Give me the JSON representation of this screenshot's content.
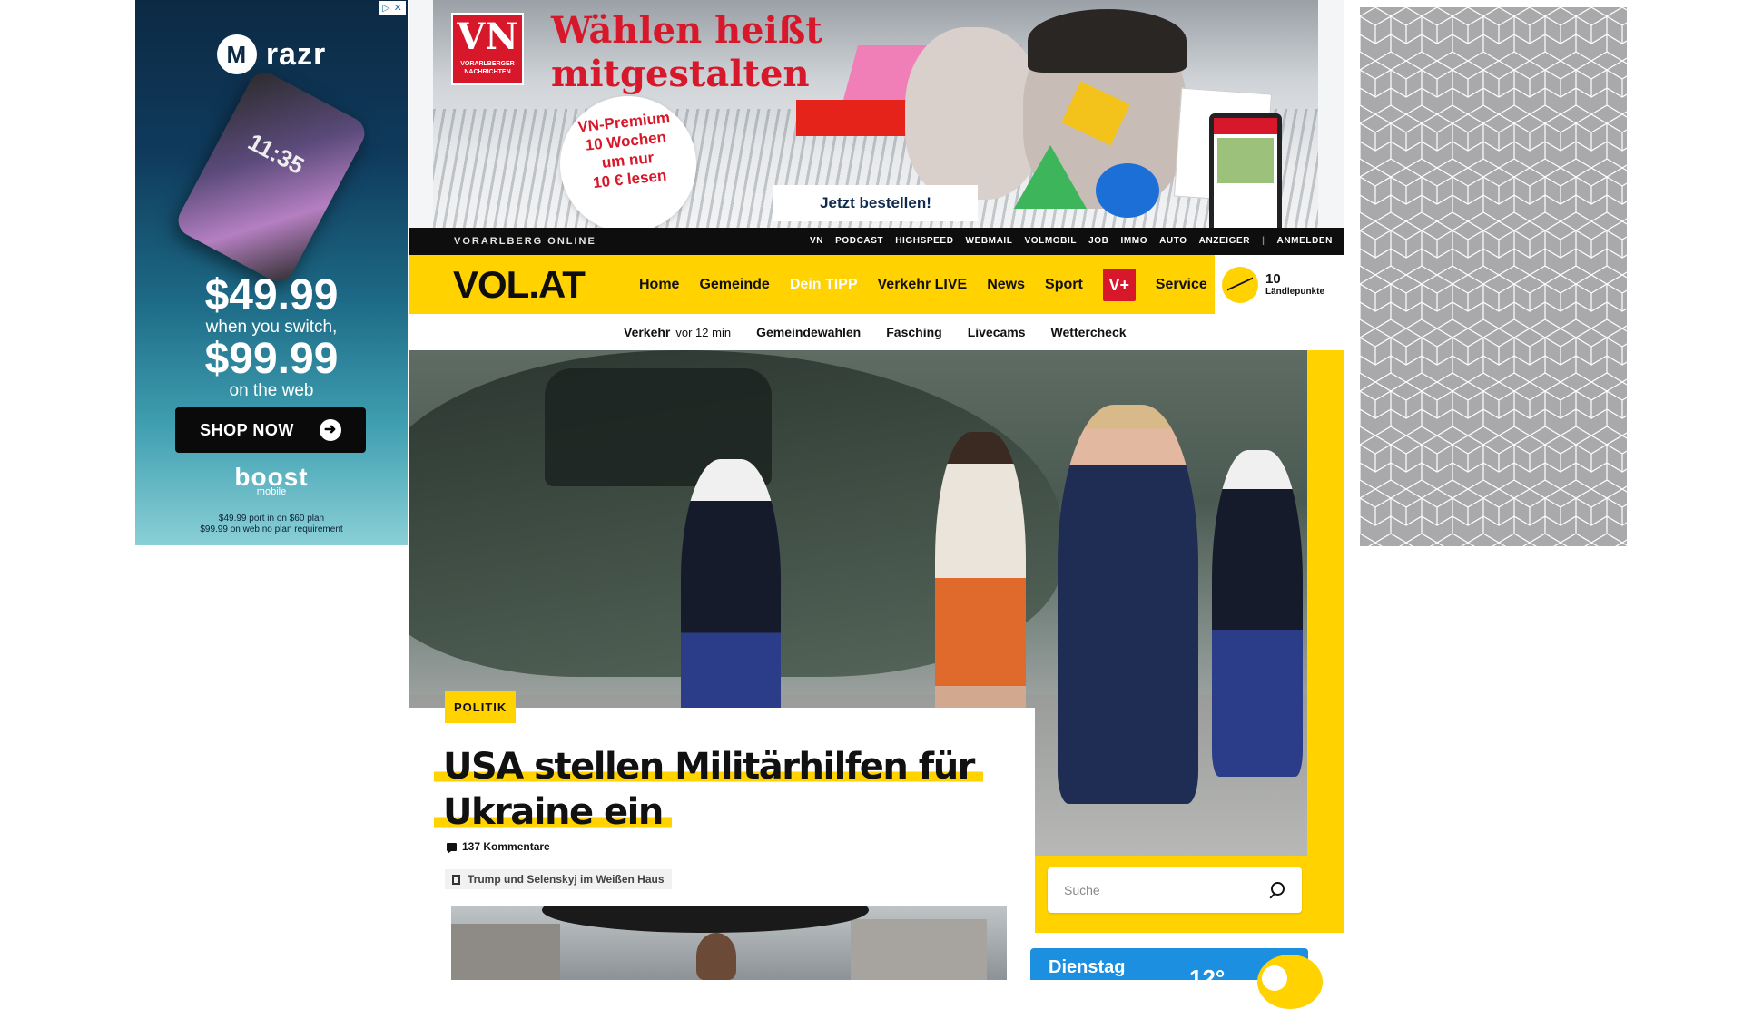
{
  "left_ad": {
    "adchoices": [
      "▷",
      "✕"
    ],
    "brand": "razr",
    "brand_logo": "M",
    "phone_time": "11:35",
    "price_primary": "$49.99",
    "price_primary_note": "when you switch,",
    "price_secondary": "$99.99",
    "price_secondary_note": "on the web",
    "cta": "SHOP NOW",
    "sponsor": "boost",
    "sponsor_sub": "mobile",
    "fine_print_1": "$49.99 port in on $60 plan",
    "fine_print_2": "$99.99 on web no plan requirement"
  },
  "top_banner": {
    "logo_text": "VN",
    "logo_sub_1": "VORARLBERGER",
    "logo_sub_2": "NACHRICHTEN",
    "headline_1": "Wählen heißt",
    "headline_2": "mitgestalten",
    "offer_1": "VN-Premium",
    "offer_2": "10 Wochen",
    "offer_3": "um nur",
    "offer_4": "10 € lesen",
    "cta": "Jetzt bestellen!"
  },
  "topbar": {
    "site_name": "VORARLBERG ONLINE",
    "links": [
      "VN",
      "PODCAST",
      "HIGHSPEED",
      "WEBMAIL",
      "VOLMOBIL",
      "JOB",
      "IMMO",
      "AUTO",
      "ANZEIGER"
    ],
    "separator": "|",
    "login": "ANMELDEN"
  },
  "mainnav": {
    "logo": "VOL.AT",
    "items": [
      "Home",
      "Gemeinde",
      "Dein TIPP",
      "Verkehr LIVE",
      "News",
      "Sport"
    ],
    "vplus": "V+",
    "service": "Service",
    "points_value": "10",
    "points_label": "Ländlepunkte"
  },
  "subnav": {
    "traffic_label": "Verkehr",
    "traffic_time": "vor 12 min",
    "items": [
      "Gemeindewahlen",
      "Fasching",
      "Livecams",
      "Wettercheck"
    ]
  },
  "article": {
    "category": "POLITIK",
    "headline_line1": "USA stellen Militärhilfen für",
    "headline_line2": "Ukraine ein",
    "comments": "137 Kommentare",
    "related": "Trump und Selenskyj im Weißen Haus"
  },
  "search": {
    "placeholder": "Suche"
  },
  "weather": {
    "day": "Dienstag",
    "temp": "12°"
  },
  "colors": {
    "brand_yellow": "#ffd200",
    "vn_red": "#d7182a",
    "topbar_black": "#0e0e0e",
    "weather_blue": "#1d8fe0"
  },
  "icons": [
    "adchoices-icon",
    "motorola-logo-icon",
    "arrow-right-icon",
    "sun-mountain-icon",
    "comment-icon",
    "document-icon",
    "search-icon",
    "weather-sun-icon"
  ]
}
